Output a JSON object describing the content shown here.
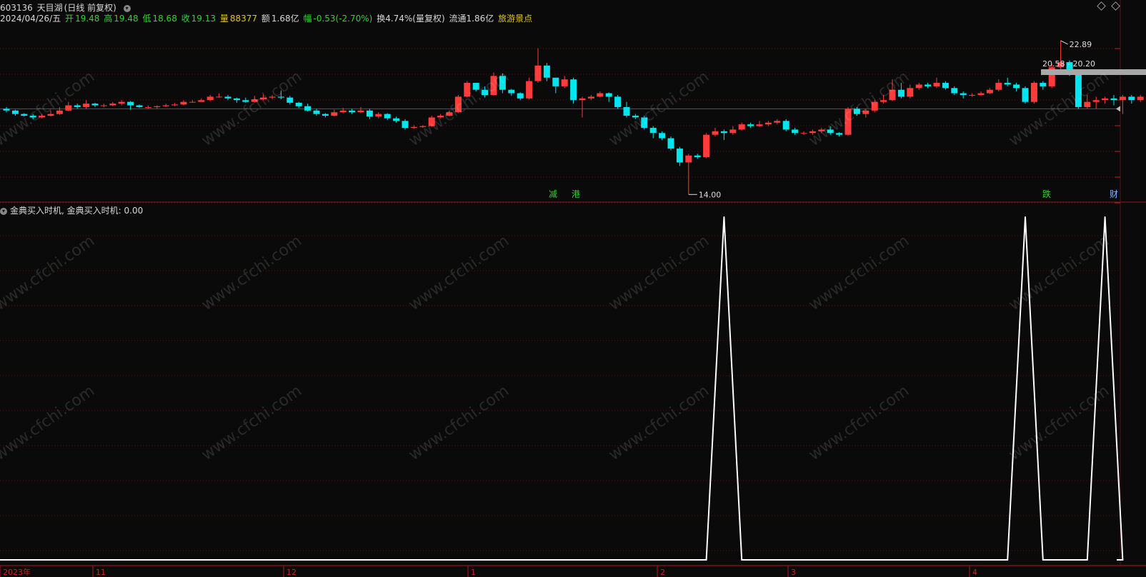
{
  "header": {
    "code": "603136",
    "name": "天目湖",
    "period": "(日线 前复权)",
    "date": "2024/04/26/五",
    "open_label": "开",
    "open": "19.48",
    "high_label": "高",
    "high": "19.48",
    "low_label": "低",
    "low": "18.68",
    "close_label": "收",
    "close": "19.13",
    "vol_label": "量",
    "vol": "88377",
    "amount_label": "额",
    "amount": "1.68亿",
    "change_label": "幅",
    "change": "-0.53(-2.70%)",
    "turnover": "换4.74%(量复权)",
    "float": "流通1.86亿",
    "sector": "旅游景点"
  },
  "indicator": {
    "title": "金典买入时机",
    "value_label": "金典买入时机: 0.00"
  },
  "annotations": {
    "high_price": "22.89",
    "low_price": "14.00",
    "range_label": "20.58 - 20.20",
    "notes": [
      "减",
      "港",
      "跌",
      "财"
    ]
  },
  "axis": {
    "month_labels": [
      "2023年",
      "11",
      "12",
      "1",
      "2",
      "3",
      "4"
    ]
  },
  "watermark": "www.cfchi.com",
  "colors": {
    "up": "#ff3b3b",
    "down": "#00e5ee",
    "background": "#0a0a0a",
    "grid": "#5a1010",
    "indicator_line": "#ffffff",
    "range_bar": "#a8a8a8"
  },
  "chart_data": [
    {
      "type": "candlestick",
      "title": "603136 天目湖(日线 前复权)",
      "ylim": [
        13.6,
        24.0
      ],
      "high": 22.89,
      "low": 14.0,
      "candles": [
        [
          18.95,
          18.85,
          19.05,
          18.75
        ],
        [
          18.85,
          18.65,
          18.9,
          18.55
        ],
        [
          18.65,
          18.55,
          18.7,
          18.5
        ],
        [
          18.55,
          18.45,
          18.65,
          18.35
        ],
        [
          18.45,
          18.55,
          18.65,
          18.4
        ],
        [
          18.55,
          18.65,
          18.85,
          18.5
        ],
        [
          18.65,
          18.85,
          19.05,
          18.6
        ],
        [
          18.85,
          19.15,
          19.35,
          18.8
        ],
        [
          19.15,
          19.05,
          19.25,
          18.95
        ],
        [
          19.05,
          19.25,
          19.45,
          18.95
        ],
        [
          19.25,
          19.15,
          19.3,
          19.05
        ],
        [
          19.15,
          19.15,
          19.25,
          19.05
        ],
        [
          19.15,
          19.25,
          19.35,
          19.1
        ],
        [
          19.25,
          19.35,
          19.45,
          19.15
        ],
        [
          19.35,
          19.15,
          19.4,
          18.9
        ],
        [
          19.15,
          19.05,
          19.2,
          19.0
        ],
        [
          19.05,
          19.05,
          19.15,
          18.95
        ],
        [
          19.05,
          19.1,
          19.15,
          18.95
        ],
        [
          19.1,
          19.15,
          19.25,
          19.05
        ],
        [
          19.15,
          19.2,
          19.3,
          19.1
        ],
        [
          19.2,
          19.35,
          19.45,
          19.15
        ],
        [
          19.35,
          19.35,
          19.45,
          19.3
        ],
        [
          19.35,
          19.45,
          19.55,
          19.35
        ],
        [
          19.45,
          19.65,
          19.75,
          19.4
        ],
        [
          19.65,
          19.65,
          19.85,
          19.6
        ],
        [
          19.65,
          19.55,
          19.75,
          19.45
        ],
        [
          19.55,
          19.45,
          19.6,
          19.3
        ],
        [
          19.45,
          19.35,
          19.6,
          19.3
        ],
        [
          19.35,
          19.5,
          19.7,
          19.3
        ],
        [
          19.5,
          19.6,
          19.8,
          19.45
        ],
        [
          19.6,
          19.65,
          19.75,
          19.55
        ],
        [
          19.65,
          19.6,
          20.0,
          19.5
        ],
        [
          19.6,
          19.3,
          19.7,
          19.2
        ],
        [
          19.3,
          19.1,
          19.35,
          19.0
        ],
        [
          19.1,
          18.85,
          19.25,
          18.8
        ],
        [
          18.85,
          18.65,
          18.95,
          18.55
        ],
        [
          18.65,
          18.55,
          18.7,
          18.45
        ],
        [
          18.55,
          18.75,
          18.9,
          18.5
        ],
        [
          18.75,
          18.85,
          19.0,
          18.7
        ],
        [
          18.85,
          18.75,
          18.95,
          18.65
        ],
        [
          18.75,
          18.85,
          19.05,
          18.7
        ],
        [
          18.85,
          18.5,
          18.95,
          18.35
        ],
        [
          18.5,
          18.65,
          18.75,
          18.4
        ],
        [
          18.65,
          18.4,
          18.7,
          18.3
        ],
        [
          18.4,
          18.25,
          18.5,
          18.15
        ],
        [
          18.25,
          17.85,
          18.35,
          17.75
        ],
        [
          17.85,
          17.9,
          18.0,
          17.8
        ],
        [
          17.9,
          17.95,
          18.0,
          17.85
        ],
        [
          17.95,
          18.45,
          18.55,
          17.9
        ],
        [
          18.45,
          18.55,
          18.65,
          18.4
        ],
        [
          18.55,
          18.75,
          18.85,
          18.5
        ],
        [
          18.75,
          19.65,
          19.75,
          18.7
        ],
        [
          19.65,
          20.45,
          20.55,
          19.6
        ],
        [
          20.45,
          20.05,
          20.35,
          19.95
        ],
        [
          20.05,
          19.75,
          20.25,
          19.6
        ],
        [
          19.75,
          20.85,
          21.05,
          19.7
        ],
        [
          20.85,
          20.05,
          21.0,
          19.85
        ],
        [
          20.05,
          19.85,
          20.1,
          19.7
        ],
        [
          19.85,
          19.55,
          19.9,
          19.45
        ],
        [
          19.55,
          20.55,
          20.75,
          19.5
        ],
        [
          20.55,
          21.45,
          22.45,
          20.45
        ],
        [
          21.45,
          20.75,
          21.6,
          20.55
        ],
        [
          20.75,
          20.25,
          20.45,
          19.85
        ],
        [
          20.25,
          20.65,
          20.85,
          20.15
        ],
        [
          20.65,
          19.45,
          20.75,
          19.25
        ],
        [
          19.45,
          19.55,
          19.65,
          18.45
        ],
        [
          19.55,
          19.65,
          19.75,
          19.45
        ],
        [
          19.65,
          19.85,
          19.95,
          19.6
        ],
        [
          19.85,
          19.65,
          19.9,
          19.35
        ],
        [
          19.65,
          19.05,
          19.75,
          18.95
        ],
        [
          19.05,
          18.55,
          19.35,
          18.45
        ],
        [
          18.55,
          18.45,
          18.65,
          18.35
        ],
        [
          18.45,
          17.85,
          18.55,
          17.75
        ],
        [
          17.85,
          17.55,
          17.95,
          17.25
        ],
        [
          17.55,
          17.25,
          17.65,
          17.15
        ],
        [
          17.25,
          16.65,
          17.35,
          16.55
        ],
        [
          16.65,
          15.85,
          16.75,
          15.65
        ],
        [
          15.85,
          16.25,
          16.35,
          14.0
        ],
        [
          16.25,
          16.15,
          16.35,
          16.05
        ],
        [
          16.15,
          17.45,
          17.55,
          16.1
        ],
        [
          17.45,
          17.65,
          17.85,
          17.35
        ],
        [
          17.65,
          17.55,
          17.75,
          17.15
        ],
        [
          17.55,
          17.75,
          17.95,
          17.45
        ],
        [
          17.75,
          18.05,
          18.15,
          17.7
        ],
        [
          18.05,
          17.95,
          18.15,
          17.85
        ],
        [
          17.95,
          18.05,
          18.25,
          17.9
        ],
        [
          18.05,
          18.15,
          18.25,
          17.95
        ],
        [
          18.15,
          18.25,
          18.35,
          18.05
        ],
        [
          18.25,
          17.75,
          18.35,
          17.65
        ],
        [
          17.75,
          17.55,
          17.85,
          17.45
        ],
        [
          17.55,
          17.55,
          17.65,
          17.45
        ],
        [
          17.55,
          17.65,
          17.75,
          17.45
        ],
        [
          17.65,
          17.75,
          17.85,
          17.55
        ],
        [
          17.75,
          17.55,
          17.95,
          17.45
        ],
        [
          17.55,
          17.45,
          17.6,
          17.35
        ],
        [
          17.45,
          18.95,
          19.05,
          17.4
        ],
        [
          18.95,
          18.65,
          19.05,
          18.55
        ],
        [
          18.65,
          18.85,
          18.95,
          18.45
        ],
        [
          18.85,
          19.35,
          19.45,
          18.75
        ],
        [
          19.35,
          19.45,
          19.75,
          19.25
        ],
        [
          19.45,
          20.05,
          20.65,
          19.4
        ],
        [
          20.05,
          19.65,
          20.45,
          19.55
        ],
        [
          19.65,
          20.15,
          20.35,
          19.55
        ],
        [
          20.15,
          20.35,
          20.45,
          20.05
        ],
        [
          20.35,
          20.25,
          20.45,
          20.15
        ],
        [
          20.25,
          20.45,
          20.75,
          20.15
        ],
        [
          20.45,
          20.15,
          20.55,
          20.05
        ],
        [
          20.15,
          19.85,
          20.25,
          19.75
        ],
        [
          19.85,
          19.75,
          19.95,
          19.55
        ],
        [
          19.75,
          19.75,
          19.85,
          19.65
        ],
        [
          19.75,
          19.85,
          19.95,
          19.7
        ],
        [
          19.85,
          20.05,
          20.15,
          19.8
        ],
        [
          20.05,
          20.45,
          20.65,
          19.95
        ],
        [
          20.45,
          20.35,
          20.75,
          20.25
        ],
        [
          20.35,
          20.15,
          20.45,
          19.95
        ],
        [
          20.15,
          19.35,
          20.25,
          19.25
        ],
        [
          19.35,
          20.45,
          20.55,
          19.25
        ],
        [
          20.45,
          20.25,
          20.55,
          20.05
        ],
        [
          20.25,
          21.35,
          21.55,
          20.15
        ],
        [
          21.35,
          21.65,
          22.89,
          21.25
        ],
        [
          21.65,
          21.05,
          21.75,
          20.85
        ],
        [
          21.05,
          19.05,
          21.15,
          18.95
        ],
        [
          19.05,
          19.35,
          19.75,
          18.95
        ],
        [
          19.35,
          19.45,
          19.65,
          18.95
        ],
        [
          19.45,
          19.55,
          19.65,
          19.25
        ],
        [
          19.55,
          19.45,
          19.75,
          19.15
        ],
        [
          19.45,
          19.65,
          19.75,
          18.65
        ],
        [
          19.65,
          19.45,
          19.75,
          19.25
        ],
        [
          19.45,
          19.65,
          19.75,
          19.35
        ],
        [
          19.65,
          19.55,
          19.75,
          19.45
        ],
        [
          19.55,
          19.25,
          19.65,
          19.05
        ]
      ]
    },
    {
      "type": "line",
      "title": "金典买入时机",
      "ylim": [
        0,
        1
      ],
      "series": [
        {
          "name": "金典买入时机",
          "x": [
            0,
            79,
            80,
            81,
            82,
            83,
            84,
            113,
            114,
            115,
            116,
            117,
            122,
            123,
            124,
            125,
            126
          ],
          "values": [
            0,
            0,
            0.5,
            1,
            0.5,
            0,
            0,
            0,
            0.5,
            1,
            0.5,
            0,
            0,
            0.5,
            1,
            0.5,
            0
          ]
        }
      ]
    }
  ]
}
